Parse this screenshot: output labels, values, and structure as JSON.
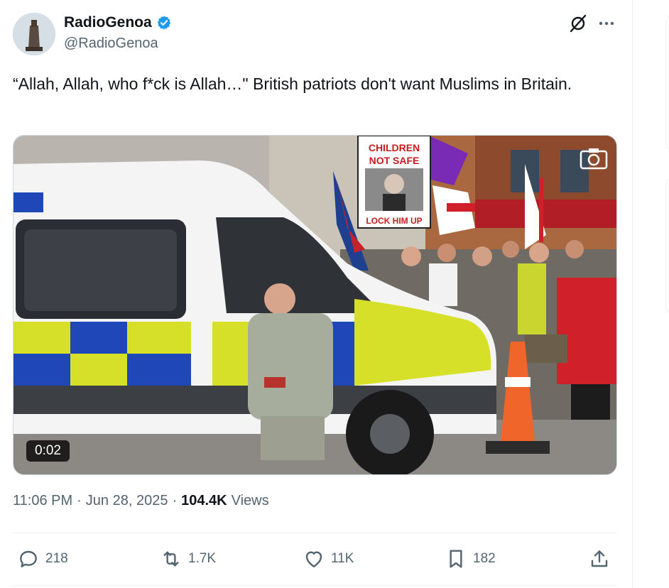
{
  "author": {
    "display_name": "RadioGenoa",
    "handle": "@RadioGenoa",
    "verified": true,
    "verified_color": "#1d9bf0"
  },
  "tweet": {
    "text": "“Allah, Allah, who f*ck is Allah…\" British patriots don't want Muslims in Britain."
  },
  "media": {
    "type": "video",
    "duration": "0:02",
    "sign_text_top": "CHILDREN NOT SAFE",
    "sign_text_bottom": "LOCK HIM UP"
  },
  "meta": {
    "time": "11:06 PM",
    "separator": "·",
    "date": "Jun 28, 2025",
    "views_count": "104.4K",
    "views_label": "Views"
  },
  "actions": {
    "replies": "218",
    "reposts": "1.7K",
    "likes": "11K",
    "bookmarks": "182"
  },
  "icons": [
    "verified-badge-icon",
    "grok-icon",
    "more-icon",
    "camera-icon",
    "reply-icon",
    "repost-icon",
    "like-icon",
    "bookmark-icon",
    "share-icon"
  ]
}
